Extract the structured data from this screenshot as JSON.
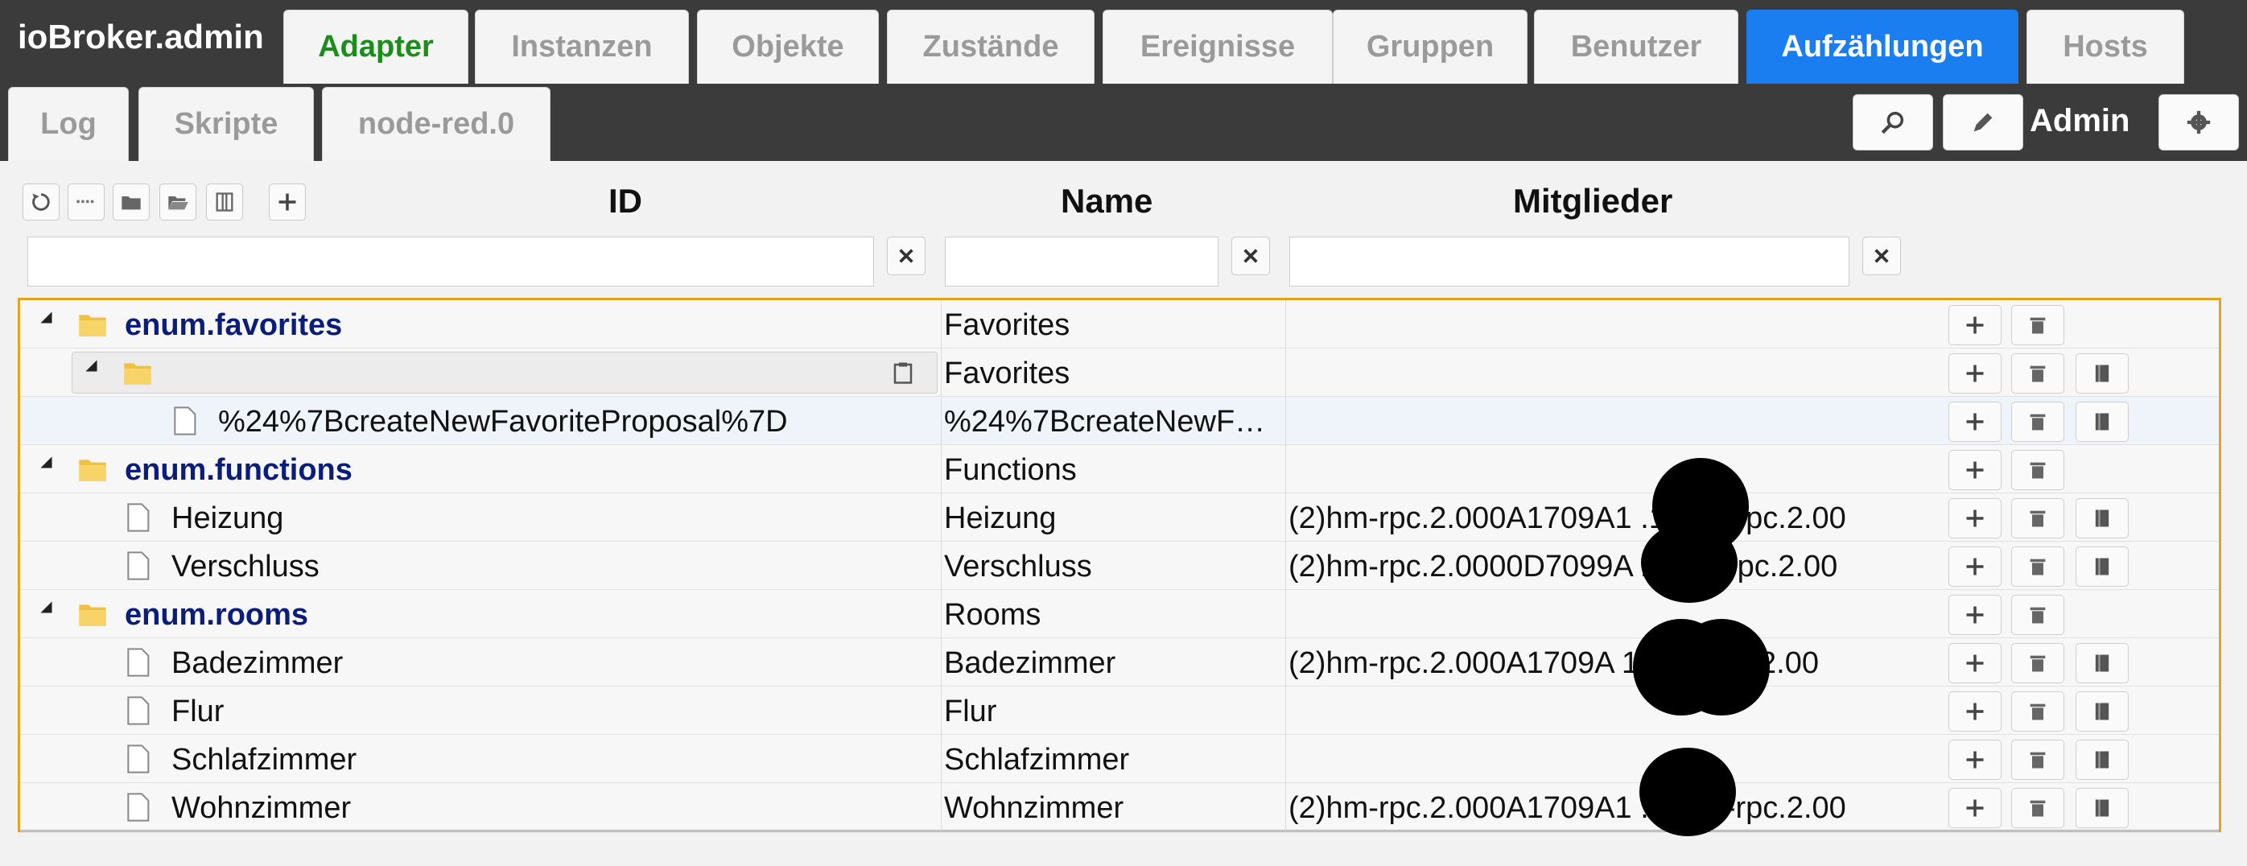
{
  "header": {
    "title": "ioBroker.admin",
    "tabs_row1": [
      "Adapter",
      "Instanzen",
      "Objekte",
      "Zustände",
      "Ereignisse",
      "Gruppen",
      "Benutzer",
      "Aufzählungen",
      "Hosts"
    ],
    "tabs_row2": [
      "Log",
      "Skripte",
      "node-red.0"
    ],
    "active_tab": "Aufzählungen",
    "user": "Admin"
  },
  "columns": {
    "id": "ID",
    "name": "Name",
    "members": "Mitglieder"
  },
  "filters": {
    "id": "",
    "name": "",
    "members": ""
  },
  "rows": [
    {
      "id": "enum.favorites",
      "name": "Favorites",
      "members": ""
    },
    {
      "id": "",
      "name": "Favorites",
      "members": ""
    },
    {
      "id": "%24%7BcreateNewFavoriteProposal%7D",
      "name": "%24%7BcreateNewFa…",
      "members": ""
    },
    {
      "id": "enum.functions",
      "name": "Functions",
      "members": ""
    },
    {
      "id": "Heizung",
      "name": "Heizung",
      "members": "(2)hm-rpc.2.000A1709A1 .1, hm-rpc.2.00"
    },
    {
      "id": "Verschluss",
      "name": "Verschluss",
      "members": "(2)hm-rpc.2.0000D7099A 1, hm-rpc.2.00"
    },
    {
      "id": "enum.rooms",
      "name": "Rooms",
      "members": ""
    },
    {
      "id": "Badezimmer",
      "name": "Badezimmer",
      "members": "(2)hm-rpc.2.000A1709A 1, hm-rpc.2.00"
    },
    {
      "id": "Flur",
      "name": "Flur",
      "members": ""
    },
    {
      "id": "Schlafzimmer",
      "name": "Schlafzimmer",
      "members": ""
    },
    {
      "id": "Wohnzimmer",
      "name": "Wohnzimmer",
      "members": "(2)hm-rpc.2.000A1709A1 .1, hm-rpc.2.00"
    }
  ],
  "icons": {
    "toolbar": [
      "refresh-icon",
      "list-icon",
      "folder-icon",
      "folder-open-icon",
      "book-icon",
      "plus-icon"
    ],
    "row": [
      "plus-icon",
      "trash-icon",
      "edit-icon"
    ],
    "header": [
      "search-icon",
      "pencil-icon",
      "gear-icon"
    ]
  },
  "colors": {
    "accent": "#1a7ef0",
    "active_green": "#1a8d1a",
    "group_text": "#0b1d7a",
    "border": "#e2a321"
  }
}
